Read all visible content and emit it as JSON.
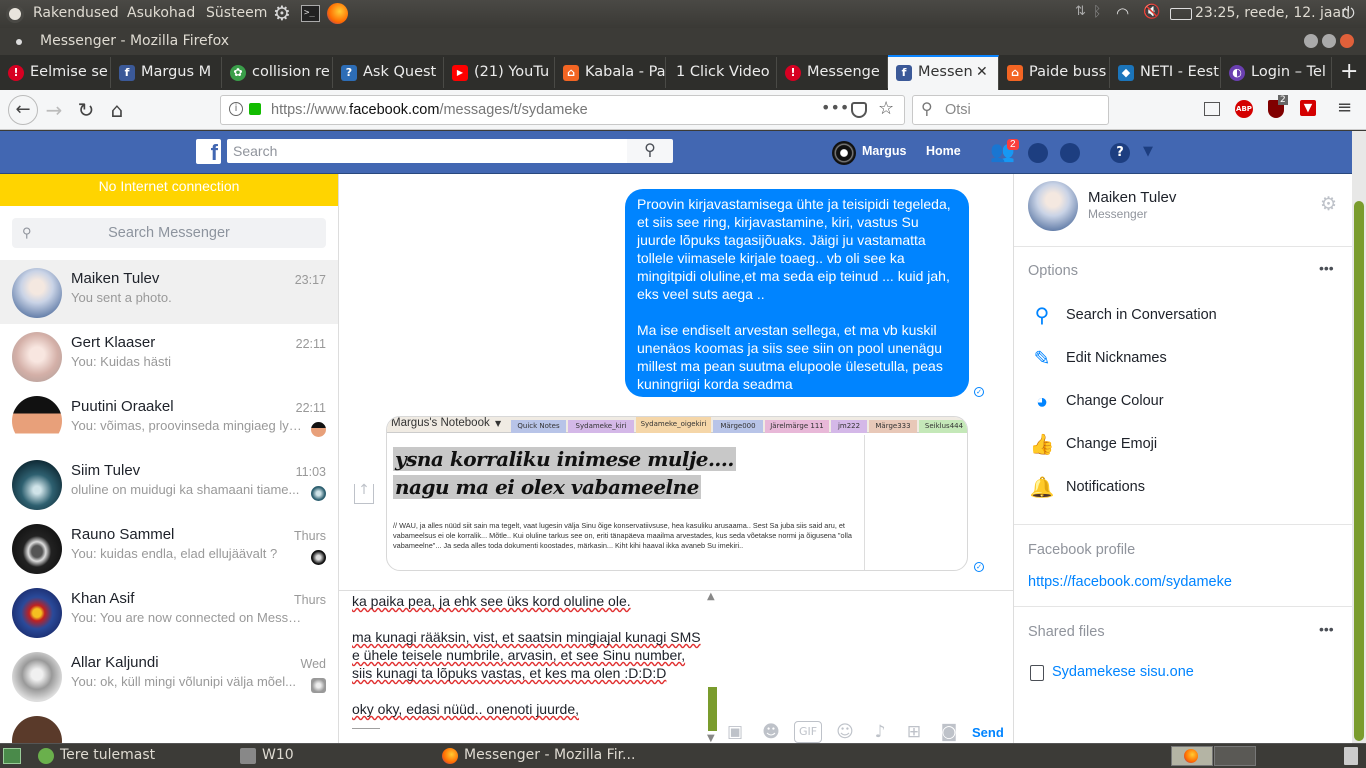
{
  "top_panel": {
    "menus": [
      "Rakendused",
      "Asukohad",
      "Süsteem"
    ],
    "clock": "23:25, reede, 12. jaan"
  },
  "window": {
    "title": "Messenger - Mozilla Firefox"
  },
  "tabs": [
    {
      "label": "Eelmise se",
      "icon": "warning-icon",
      "color": "#d70022"
    },
    {
      "label": "Margus M",
      "icon": "facebook-icon",
      "color": "#3b5998"
    },
    {
      "label": "collision re",
      "icon": "generic-site-icon",
      "color": "#3a9e4a"
    },
    {
      "label": "Ask Quest",
      "icon": "question-icon",
      "color": "#2d6db6"
    },
    {
      "label": "(21) YouTu",
      "icon": "youtube-icon",
      "color": "#ff0000"
    },
    {
      "label": "Kabala - Pa",
      "icon": "site-icon",
      "color": "#f36523"
    },
    {
      "label": "1 Click Video",
      "icon": "none",
      "color": "#2e2e2b"
    },
    {
      "label": "Messenge",
      "icon": "warning-icon",
      "color": "#d70022"
    },
    {
      "label": "Messen",
      "icon": "facebook-icon",
      "color": "#3b5998",
      "active": true
    },
    {
      "label": "Paide buss",
      "icon": "site-icon",
      "color": "#f36523"
    },
    {
      "label": "NETI - Eest",
      "icon": "site-icon",
      "color": "#1b75bb"
    },
    {
      "label": "Login – Tel",
      "icon": "site-icon",
      "color": "#6a3fb0"
    }
  ],
  "navbar": {
    "url_prefix": "https://www.",
    "url_domain": "facebook.com",
    "url_path": "/messages/t/sydameke",
    "search_placeholder": "Otsi",
    "badge_count": "2"
  },
  "fb_header": {
    "search_placeholder": "Search",
    "user_name": "Margus",
    "home_label": "Home",
    "friend_requests": "2"
  },
  "left": {
    "offline_banner": "No Internet connection",
    "search_placeholder": "Search Messenger",
    "conversations": [
      {
        "name": "Maiken Tulev",
        "time": "23:17",
        "preview": "You sent a photo.",
        "selected": true,
        "avatar_color": "#a8b8d0"
      },
      {
        "name": "Gert Klaaser",
        "time": "22:11",
        "preview": "You: Kuidas hästi",
        "avatar_color": "#d8b8b0"
      },
      {
        "name": "Puutini Oraakel",
        "time": "22:11",
        "preview": "You: võimas, proovinseda mingiaeg lyk...",
        "avatar_color": "#e07a50"
      },
      {
        "name": "Siim Tulev",
        "time": "11:03",
        "preview": "oluline on muidugi ka shamaani tiame...",
        "avatar_color": "#4a7a8a"
      },
      {
        "name": "Rauno Sammel",
        "time": "Thurs",
        "preview": "You: kuidas endla, elad ellujäävalt ?",
        "avatar_color": "#3a3a3a"
      },
      {
        "name": "Khan Asif",
        "time": "Thurs",
        "preview": "You: You are now connected on Messen...",
        "avatar_color": "#2a4a9a"
      },
      {
        "name": "Allar Kaljundi",
        "time": "Wed",
        "preview": "You: ok, küll mingi võlunipi välja mõel...",
        "avatar_color": "#bbbbbb"
      }
    ]
  },
  "middle": {
    "bubble_p1": "Proovin kirjavastamisega ühte ja teisipidi tegeleda, et siis see ring, kirjavastamine, kiri, vastus Su juurde lõpuks tagasijõuaks. Jäigi ju vastamatta tollele viimasele kirjale toaeg.. vb oli see ka mingitpidi oluline,et ma seda eip teinud ... kuid jah, eks veel suts aega ..",
    "bubble_p2": "Ma ise endiselt arvestan sellega, et ma vb kuskil unenäos koomas ja siis see siin on pool unenägu millest ma pean suutma elupoole ülesetulla, peas kuningriigi korda seadma",
    "photo": {
      "notebook": "Margus's Notebook",
      "tabs": [
        "Quick Notes",
        "Sydameke_kiri",
        "Sydameke_oigekiri",
        "Märge000",
        "Järelmärge 111",
        "jm222",
        "Märge333",
        "Seiklus444"
      ],
      "headline1": "ysna korraliku inimese mulje....",
      "headline2": "nagu ma ei olex vabameelne",
      "body": "// WAU, ja alles nüüd siit sain ma tegelt, vaat lugesin välja Sinu õige konservatiivsuse, hea kasuliku arusaama.. Sest Sa juba siis said aru, et vabameelsus ei ole korralik... Mõtle.. Kui oluline tarkus see on, eriti tänapäeva maailma arvestades, kus seda võetakse normi ja õigusena \"olla vabameelne\"... Ja seda alles toda dokumenti koostades, märkasin... Kiht kihi haaval ikka avaneb Su imekiri.."
    },
    "composer": {
      "line0": "ka paika pea, ja ehk see üks kord oluline ole.",
      "line1": "ma kunagi rääksin, vist, et saatsin mingiajal kunagi SMS",
      "line2": "e ühele teisele numbrile, arvasin, et see Sinu number,",
      "line3": "siis kunagi ta lõpuks vastas, et kes ma olen :D:D:D",
      "line4": "oky oky, edasi nüüd.. onenoti juurde,",
      "line5": "——",
      "send_label": "Send",
      "gif_label": "GIF"
    }
  },
  "right": {
    "contact_name": "Maiken Tulev",
    "contact_sub": "Messenger",
    "options_label": "Options",
    "options": [
      {
        "label": "Search in Conversation",
        "icon": "search-icon"
      },
      {
        "label": "Edit Nicknames",
        "icon": "pencil-icon"
      },
      {
        "label": "Change Colour",
        "icon": "palette-icon"
      },
      {
        "label": "Change Emoji",
        "icon": "thumbs-up-icon"
      },
      {
        "label": "Notifications",
        "icon": "bell-icon"
      }
    ],
    "profile_label": "Facebook profile",
    "profile_link": "https://facebook.com/sydameke",
    "shared_label": "Shared files",
    "shared_file": "Sydamekese sisu.one"
  },
  "taskbar": {
    "items": [
      "Tere tulemast",
      "W10",
      "Messenger - Mozilla Fir..."
    ]
  }
}
